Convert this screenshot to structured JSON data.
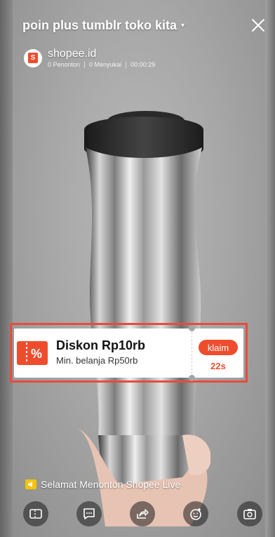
{
  "header": {
    "title": "poin plus tumblr toko kita",
    "dropdown_caret": "▾"
  },
  "shop": {
    "avatar_letter": "S",
    "name": "shopee.id",
    "viewers": "0 Penonton",
    "likes": "0 Menyukai",
    "duration": "00:00:29"
  },
  "voucher": {
    "icon": "%",
    "title": "Diskon Rp10rb",
    "subtitle": "Min. belanja Rp50rb",
    "claim_label": "klaim",
    "countdown": "22s",
    "accent_color": "#ee4d2d"
  },
  "footer": {
    "welcome_text": "Selamat Menonton Shopee Live",
    "icons": [
      "voucher-icon",
      "chat-icon",
      "share-icon",
      "add-reaction-icon",
      "camera-flip-icon"
    ]
  }
}
